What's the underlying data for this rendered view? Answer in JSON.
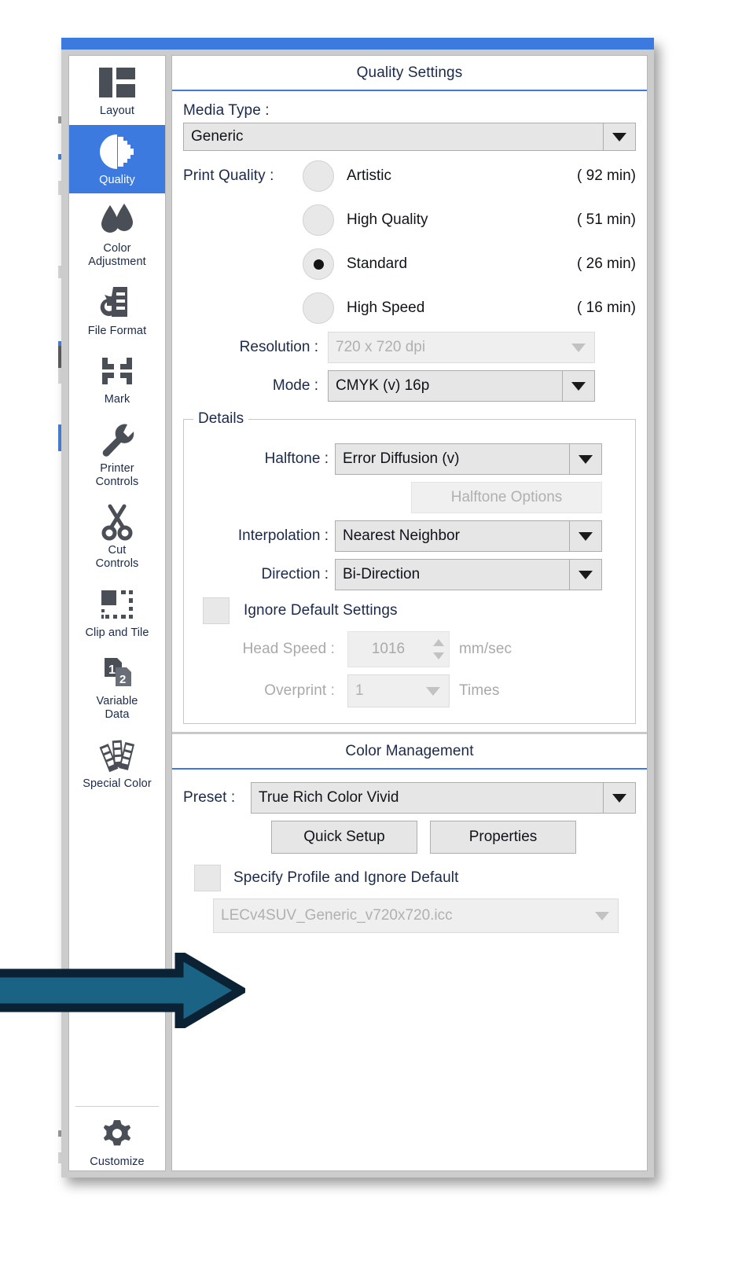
{
  "sidebar": {
    "items": [
      {
        "label": "Layout",
        "icon": "layout-icon",
        "active": false
      },
      {
        "label": "Quality",
        "icon": "quality-icon",
        "active": true
      },
      {
        "label": "Color\nAdjustment",
        "icon": "ink-drops-icon",
        "active": false
      },
      {
        "label": "File Format",
        "icon": "file-format-icon",
        "active": false
      },
      {
        "label": "Mark",
        "icon": "crop-mark-icon",
        "active": false
      },
      {
        "label": "Printer\nControls",
        "icon": "wrench-icon",
        "active": false
      },
      {
        "label": "Cut\nControls",
        "icon": "scissors-icon",
        "active": false
      },
      {
        "label": "Clip and Tile",
        "icon": "clip-tile-icon",
        "active": false
      },
      {
        "label": "Variable\nData",
        "icon": "variable-data-icon",
        "active": false
      },
      {
        "label": "Special Color",
        "icon": "swatch-fan-icon",
        "active": false
      }
    ],
    "bottom": {
      "label": "Customize",
      "icon": "gear-icon"
    }
  },
  "quality_settings": {
    "title": "Quality Settings",
    "media_type_label": "Media Type :",
    "media_type_value": "Generic",
    "print_quality_label": "Print Quality :",
    "print_quality_options": [
      {
        "label": "Artistic",
        "time": "( 92 min)",
        "selected": false
      },
      {
        "label": "High Quality",
        "time": "( 51 min)",
        "selected": false
      },
      {
        "label": "Standard",
        "time": "( 26 min)",
        "selected": true
      },
      {
        "label": "High Speed",
        "time": "( 16 min)",
        "selected": false
      }
    ],
    "resolution_label": "Resolution :",
    "resolution_value": "720 x 720 dpi",
    "mode_label": "Mode :",
    "mode_value": "CMYK (v) 16p",
    "details": {
      "title": "Details",
      "halftone_label": "Halftone :",
      "halftone_value": "Error Diffusion (v)",
      "halftone_options_button": "Halftone Options",
      "interpolation_label": "Interpolation :",
      "interpolation_value": "Nearest Neighbor",
      "direction_label": "Direction :",
      "direction_value": "Bi-Direction",
      "ignore_default_label": "Ignore Default Settings",
      "ignore_default_checked": false,
      "head_speed_label": "Head Speed :",
      "head_speed_value": "1016",
      "head_speed_unit": "mm/sec",
      "overprint_label": "Overprint :",
      "overprint_value": "1",
      "overprint_unit": "Times"
    }
  },
  "color_management": {
    "title": "Color Management",
    "preset_label": "Preset :",
    "preset_value": "True Rich Color Vivid",
    "quick_setup_button": "Quick Setup",
    "properties_button": "Properties",
    "specify_profile_label": "Specify Profile and Ignore Default",
    "specify_profile_checked": false,
    "profile_value": "LECv4SUV_Generic_v720x720.icc"
  },
  "colors": {
    "accent": "#3d7ae0",
    "title_text": "#1b2a4a",
    "annotation_fill": "#1b6385",
    "annotation_stroke": "#0a2233",
    "disabled_text": "#a9a9a9",
    "field_bg": "#e6e6e6",
    "dialog_chrome": "#cccccc"
  },
  "annotation": {
    "name": "pointer-arrow",
    "direction": "right"
  }
}
